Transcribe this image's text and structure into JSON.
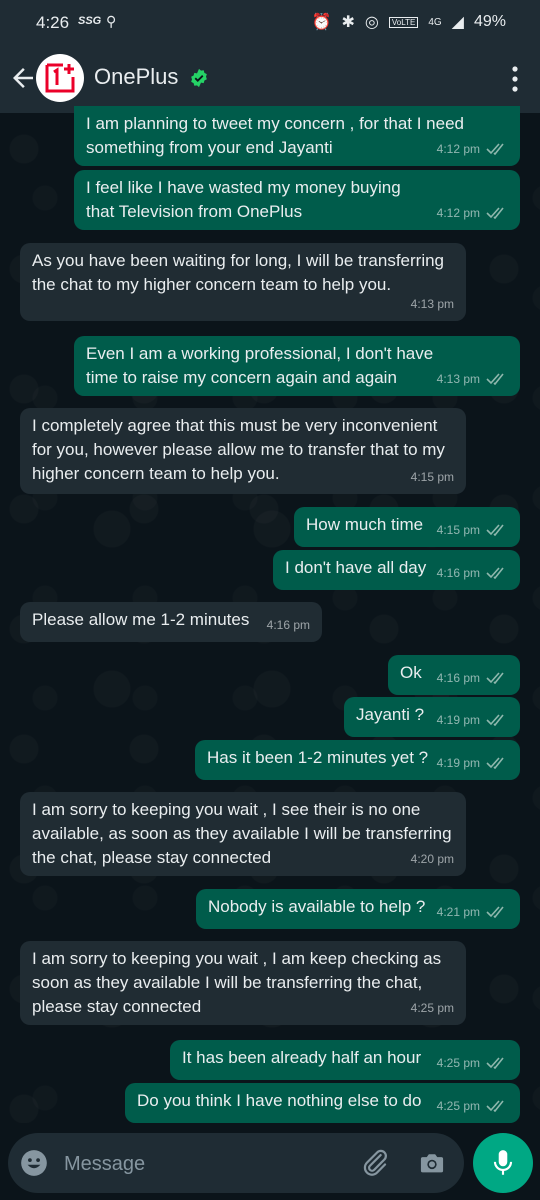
{
  "status_bar": {
    "time": "4:26",
    "carrier": "SSG",
    "network": "4G",
    "lte": "VoLTE",
    "battery": "49%"
  },
  "header": {
    "contact_name": "OnePlus",
    "verified": true
  },
  "messages": [
    {
      "direction": "out",
      "text": "I am planning to tweet my concern , for that I need something from your end Jayanti",
      "time": "4:12 pm",
      "read": true
    },
    {
      "direction": "out",
      "text": "I feel like I have wasted my money buying that Television from OnePlus",
      "time": "4:12 pm",
      "read": true
    },
    {
      "direction": "in",
      "text": "As you have been waiting for long, I will be transferring the chat to my higher concern team to help you.",
      "time": "4:13 pm"
    },
    {
      "direction": "out",
      "text": "Even I am a working professional, I don't have time to raise my concern again and again",
      "time": "4:13 pm",
      "read": true
    },
    {
      "direction": "in",
      "text": "I completely agree that this must be very inconvenient for you, however please allow me to transfer that to my higher concern team to help you.",
      "time": "4:15 pm"
    },
    {
      "direction": "out",
      "text": "How much time",
      "time": "4:15 pm",
      "read": true
    },
    {
      "direction": "out",
      "text": "I don't have all day",
      "time": "4:16 pm",
      "read": true
    },
    {
      "direction": "in",
      "text": "Please allow me 1-2 minutes",
      "time": "4:16 pm"
    },
    {
      "direction": "out",
      "text": "Ok",
      "time": "4:16 pm",
      "read": true
    },
    {
      "direction": "out",
      "text": "Jayanti ?",
      "time": "4:19 pm",
      "read": true
    },
    {
      "direction": "out",
      "text": "Has it been 1-2 minutes yet ?",
      "time": "4:19 pm",
      "read": true
    },
    {
      "direction": "in",
      "text": "I am sorry to keeping you wait , I see their  is no one available, as soon as they available I will be transferring the chat, please stay connected",
      "time": "4:20 pm"
    },
    {
      "direction": "out",
      "text": "Nobody is available to help ?",
      "time": "4:21 pm",
      "read": true
    },
    {
      "direction": "in",
      "text": "I am sorry to keeping you wait , I am keep checking  as soon as they available I will be transferring the chat, please stay connected",
      "time": "4:25 pm"
    },
    {
      "direction": "out",
      "text": "It has been already half an hour",
      "time": "4:25 pm",
      "read": true
    },
    {
      "direction": "out",
      "text": "Do you think I have nothing else to do",
      "time": "4:25 pm",
      "read": true
    }
  ],
  "input": {
    "placeholder": "Message"
  },
  "colors": {
    "background": "#0b141a",
    "header": "#1f2c34",
    "outgoing_bubble": "#005c4b",
    "incoming_bubble": "#202c33",
    "accent": "#00a884",
    "read_ticks": "#8fb7ad"
  }
}
